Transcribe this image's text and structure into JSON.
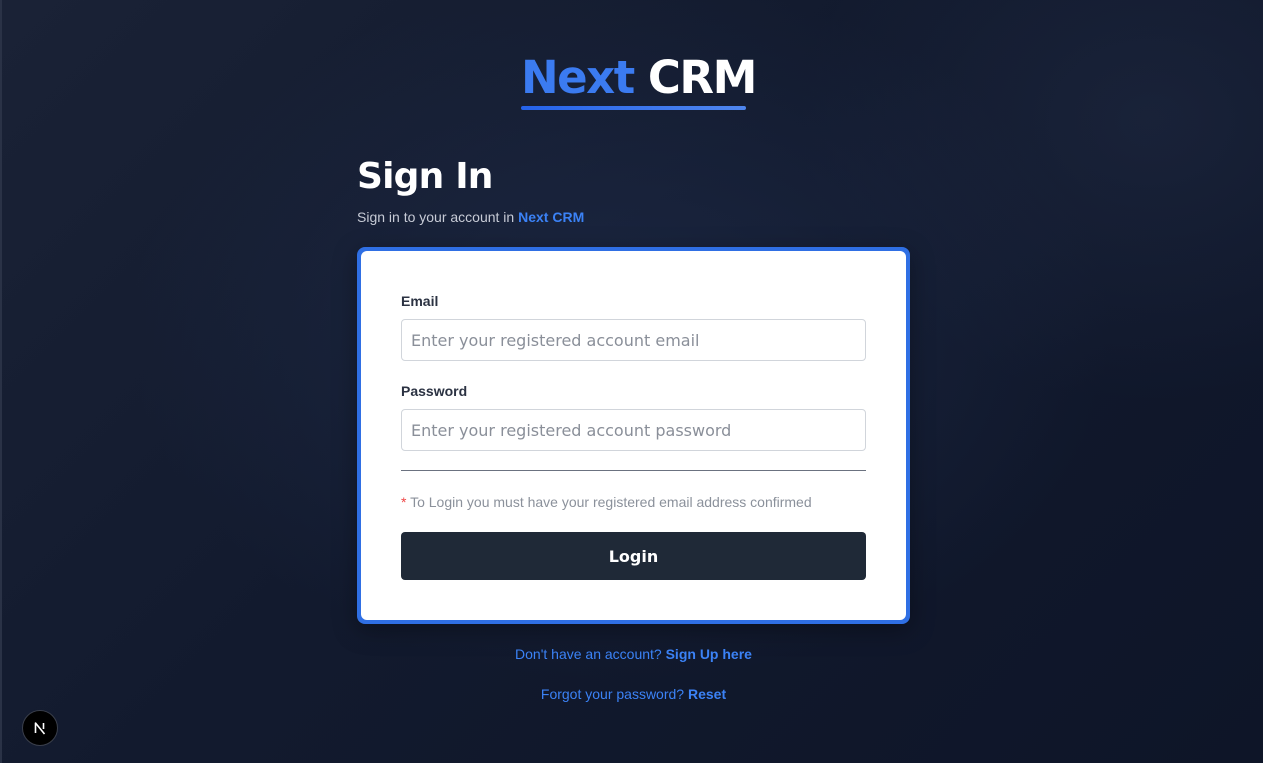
{
  "logo": {
    "word1": "Next",
    "word2": "CRM"
  },
  "header": {
    "title": "Sign In",
    "subtitle_prefix": "Sign in to your account in",
    "subtitle_brand": "Next CRM"
  },
  "form": {
    "email_label": "Email",
    "email_placeholder": "Enter your registered account email",
    "email_value": "",
    "password_label": "Password",
    "password_placeholder": "Enter your registered account password",
    "password_value": "",
    "notice_asterisk": "*",
    "notice_text": "To Login you must have your registered email address confirmed",
    "login_label": "Login"
  },
  "links": {
    "signup_prefix": "Don't have an account?",
    "signup_link": "Sign Up here",
    "forgot_prefix": "Forgot your password?",
    "forgot_link": "Reset"
  },
  "badge": {
    "icon": "nextjs-icon",
    "letter": "N"
  },
  "colors": {
    "accent": "#3b82f6",
    "brand_blue": "#3b7bf0",
    "button_bg": "#1f2937",
    "background": "#131b2e",
    "required": "#ef4444"
  }
}
